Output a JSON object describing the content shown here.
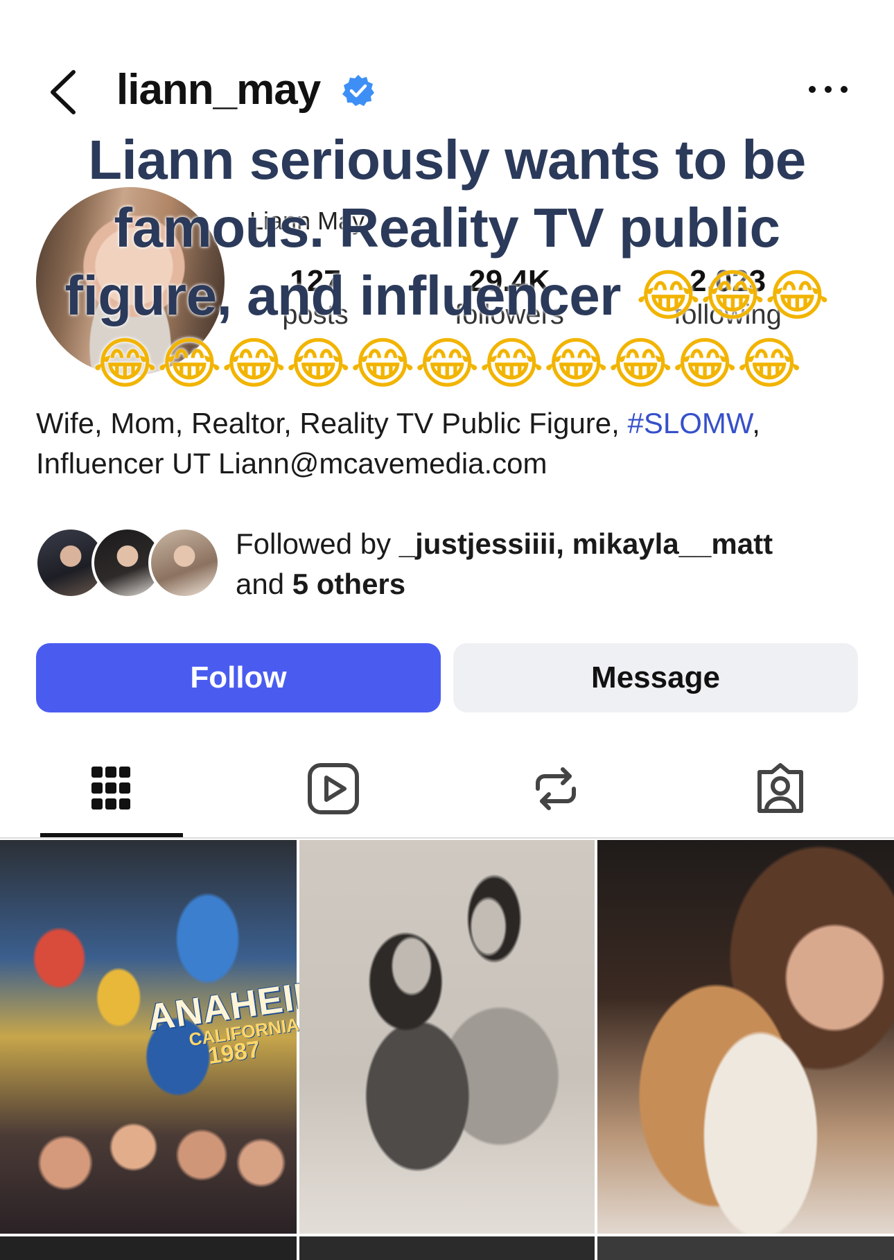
{
  "header": {
    "username": "liann_may",
    "verified_icon": "verified-badge-icon",
    "back_icon": "chevron-left-icon",
    "more_icon": "more-horizontal-icon"
  },
  "profile": {
    "full_name": "Liann May",
    "stats": {
      "posts": {
        "value": "127",
        "label": "posts"
      },
      "followers": {
        "value": "29.4K",
        "label": "followers"
      },
      "following": {
        "value": "2,023",
        "label": "following"
      }
    },
    "bio": {
      "text_before_tag": "Wife, Mom, Realtor, Reality TV Public Figure, ",
      "hashtag": "#SLOMW",
      "text_after_tag": ",",
      "line2": "Influencer   UT Liann@mcavemedia.com"
    },
    "followed_by": {
      "prefix": "Followed by ",
      "users": "_justjessiiii, mikayla__matt",
      "and": "and ",
      "others": "5 others"
    }
  },
  "overlay": {
    "text": "Liann seriously wants to be famous. Reality TV public figure, and influencer",
    "emoji_inline": "😂😂😂",
    "emoji_line": "😂😂😂😂😂😂😂😂😂😂😂"
  },
  "actions": {
    "follow_label": "Follow",
    "message_label": "Message"
  },
  "tabs": [
    {
      "name": "posts-grid",
      "icon": "grid-icon"
    },
    {
      "name": "reels",
      "icon": "reels-play-icon"
    },
    {
      "name": "reposts",
      "icon": "repost-icon"
    },
    {
      "name": "tagged",
      "icon": "tagged-person-icon"
    }
  ],
  "posts": {
    "post1_text": "ANAHEIM",
    "post1_sub": "CALIFORNIA",
    "post1_year": "1987"
  },
  "colors": {
    "accent": "#4a5cf0",
    "hashtag": "#3650c9",
    "verified": "#3d8ff6",
    "overlay_text": "#2b3a5a"
  }
}
